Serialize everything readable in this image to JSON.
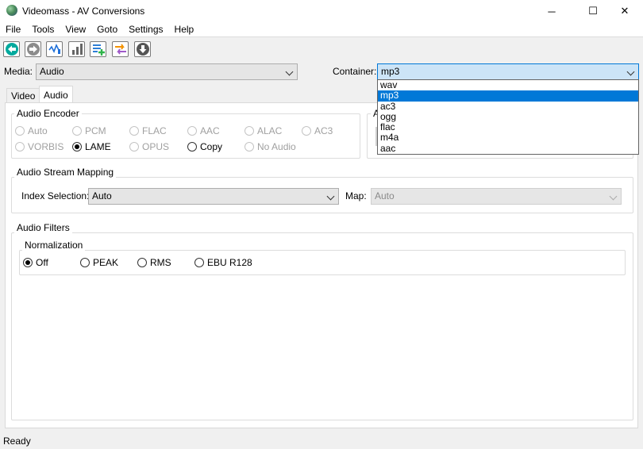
{
  "window": {
    "title": "Videomass - AV Conversions",
    "minimize": "─",
    "maximize": "☐",
    "close": "✕"
  },
  "menu": [
    "File",
    "Tools",
    "View",
    "Goto",
    "Settings",
    "Help"
  ],
  "toolbar": {
    "buttons": [
      "back-icon",
      "forward-icon",
      "audio-volume-icon",
      "peak-level-icon",
      "add-queue-icon",
      "swap-icon",
      "download-icon"
    ]
  },
  "media": {
    "label": "Media:",
    "value": "Audio"
  },
  "container": {
    "label": "Container:",
    "value": "mp3",
    "options": [
      "wav",
      "mp3",
      "ac3",
      "ogg",
      "flac",
      "m4a",
      "aac"
    ],
    "selected_index": 1
  },
  "tabs": [
    {
      "label": "Video",
      "active": false
    },
    {
      "label": "Audio",
      "active": true
    }
  ],
  "audio_encoder": {
    "title": "Audio Encoder",
    "options": [
      {
        "label": "Auto",
        "checked": false,
        "enabled": false
      },
      {
        "label": "PCM",
        "checked": false,
        "enabled": false
      },
      {
        "label": "FLAC",
        "checked": false,
        "enabled": false
      },
      {
        "label": "AAC",
        "checked": false,
        "enabled": false
      },
      {
        "label": "ALAC",
        "checked": false,
        "enabled": false
      },
      {
        "label": "AC3",
        "checked": false,
        "enabled": false
      },
      {
        "label": "VORBIS",
        "checked": false,
        "enabled": false
      },
      {
        "label": "LAME",
        "checked": true,
        "enabled": true
      },
      {
        "label": "OPUS",
        "checked": false,
        "enabled": false
      },
      {
        "label": "Copy",
        "checked": false,
        "enabled": true
      },
      {
        "label": "No Audio",
        "checked": false,
        "enabled": false
      }
    ]
  },
  "partial_group_title": "A",
  "stream_mapping": {
    "title": "Audio Stream Mapping",
    "index_label": "Index Selection:",
    "index_value": "Auto",
    "map_label": "Map:",
    "map_value": "Auto"
  },
  "audio_filters": {
    "title": "Audio Filters",
    "normalization_title": "Normalization",
    "options": [
      {
        "label": "Off",
        "checked": true
      },
      {
        "label": "PEAK",
        "checked": false
      },
      {
        "label": "RMS",
        "checked": false
      },
      {
        "label": "EBU R128",
        "checked": false
      }
    ]
  },
  "status": "Ready",
  "colors": {
    "accent": "#0078d7",
    "toolbar_teal": "#00a99d",
    "toolbar_green": "#2fb34a",
    "toolbar_orange": "#f39200",
    "toolbar_purple": "#a05ac9"
  }
}
